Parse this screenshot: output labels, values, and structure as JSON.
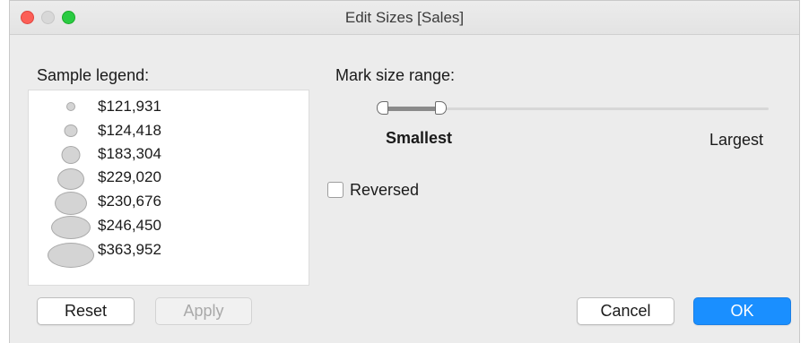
{
  "window": {
    "title": "Edit Sizes [Sales]",
    "traffic_colors": {
      "close": "#fc5f57",
      "minimize": "#d8d8d8",
      "zoom": "#2acb42"
    }
  },
  "legend": {
    "label": "Sample legend:",
    "items": [
      {
        "value": "$121,931",
        "size_level": 1
      },
      {
        "value": "$124,418",
        "size_level": 2
      },
      {
        "value": "$183,304",
        "size_level": 3
      },
      {
        "value": "$229,020",
        "size_level": 4
      },
      {
        "value": "$230,676",
        "size_level": 5
      },
      {
        "value": "$246,450",
        "size_level": 6
      },
      {
        "value": "$363,952",
        "size_level": 7
      }
    ]
  },
  "mark_size": {
    "label": "Mark size range:",
    "min_label": "Smallest",
    "max_label": "Largest",
    "range_start": 0.0,
    "range_end": 0.15
  },
  "reversed": {
    "label": "Reversed",
    "checked": false
  },
  "buttons": {
    "reset": "Reset",
    "apply": "Apply",
    "cancel": "Cancel",
    "ok": "OK"
  },
  "colors": {
    "accent": "#1a8fff"
  }
}
